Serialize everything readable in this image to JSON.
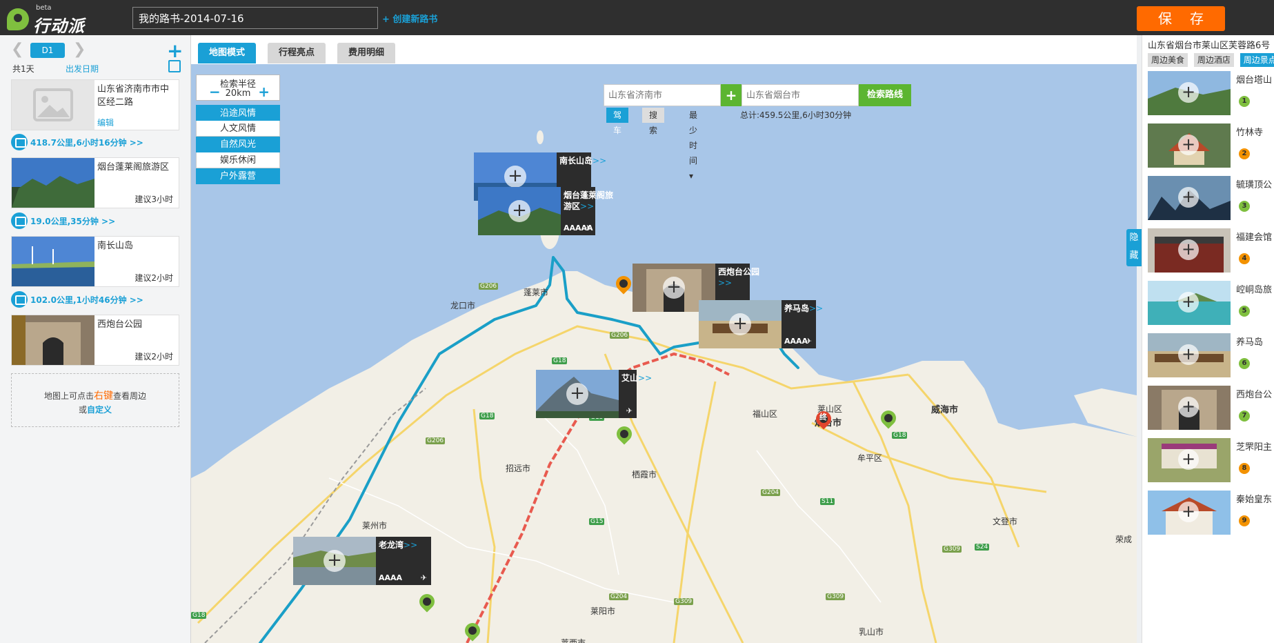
{
  "app": {
    "logo_text": "行动派",
    "beta": "beta",
    "book_title": "我的路书-2014-07-16",
    "new_book": "+ 创建新路书",
    "save": "保存"
  },
  "left": {
    "day_label": "D1",
    "total_days": "共1天",
    "depart_date": "出发日期",
    "start_place": {
      "name": "山东省济南市市中区经二路",
      "edit": "编辑"
    },
    "routes": [
      "418.7公里,6小时16分钟 >>",
      "19.0公里,35分钟 >>",
      "102.0公里,1小时46分钟 >>"
    ],
    "stops": [
      {
        "name": "烟台蓬莱阁旅游区",
        "hint": "建议3小时"
      },
      {
        "name": "南长山岛",
        "hint": "建议2小时"
      },
      {
        "name": "西炮台公园",
        "hint": "建议2小时"
      }
    ],
    "hint": {
      "pre": "地图上可点击",
      "key": "右键",
      "post": "查看周边",
      "or": "或",
      "custom": "自定义"
    }
  },
  "tabs": [
    "地图模式",
    "行程亮点",
    "费用明细"
  ],
  "map": {
    "radius_label": "检索半径",
    "radius_value": "20km",
    "filters": [
      {
        "label": "沿途风情",
        "on": true
      },
      {
        "label": "人文风情",
        "on": false
      },
      {
        "label": "自然风光",
        "on": true
      },
      {
        "label": "娱乐休闲",
        "on": false
      },
      {
        "label": "户外露营",
        "on": true
      }
    ],
    "from_placeholder": "山东省济南市",
    "to_placeholder": "山东省烟台市",
    "search_route": "检索路线",
    "opt_drive": "驾车",
    "opt_search": "搜索",
    "opt_mode": "最少时间 ▾",
    "total": "总计:459.5公里,6小时30分钟",
    "hide": "隐藏",
    "place_labels": [
      "龙口市",
      "招远市",
      "栖霞市",
      "福山区",
      "莱山区",
      "烟台市",
      "牟平区",
      "威海市",
      "文登市",
      "莱阳市",
      "乳山市",
      "荣成",
      "莱州市",
      "蓬莱市",
      "莱西市"
    ],
    "road_labels": [
      "G206",
      "G206",
      "G18",
      "G18",
      "G206",
      "G15",
      "G204",
      "G309",
      "G309",
      "S11",
      "G309",
      "S24",
      "G18",
      "G204",
      "G15",
      "G18"
    ],
    "end_label": "终",
    "poi_cards": [
      {
        "name": "南长山岛",
        "more": ">>",
        "level": ""
      },
      {
        "name": "烟台蓬莱阁旅游区",
        "more": ">>",
        "level": "AAAAA"
      },
      {
        "name": "西炮台公园",
        "more": ">>",
        "level": ""
      },
      {
        "name": "养马岛",
        "more": ">>",
        "level": "AAAA"
      },
      {
        "name": "艾山",
        "more": ">>",
        "level": ""
      },
      {
        "name": "老龙湾",
        "more": ">>",
        "level": "AAAA"
      }
    ]
  },
  "right": {
    "address": "山东省烟台市莱山区芙蓉路6号",
    "tabs": [
      "周边美食",
      "周边酒店",
      "周边景点"
    ],
    "items": [
      {
        "name": "烟台塔山",
        "num": "1"
      },
      {
        "name": "竹林寺",
        "num": "2"
      },
      {
        "name": "毓璜顶公",
        "num": "3"
      },
      {
        "name": "福建会馆",
        "num": "4"
      },
      {
        "name": "崆峒岛旅",
        "num": "5"
      },
      {
        "name": "养马岛",
        "num": "6"
      },
      {
        "name": "西炮台公",
        "num": "7"
      },
      {
        "name": "芝罘阳主",
        "num": "8"
      },
      {
        "name": "秦始皇东",
        "num": "9"
      }
    ]
  },
  "colors": {
    "accent": "#1aa0d6",
    "save": "#ff6a00",
    "green": "#5cb531",
    "sea": "#a8c6e8",
    "land": "#f2efe6",
    "route": "#1a9fc7",
    "highway": "#e85a4f"
  }
}
